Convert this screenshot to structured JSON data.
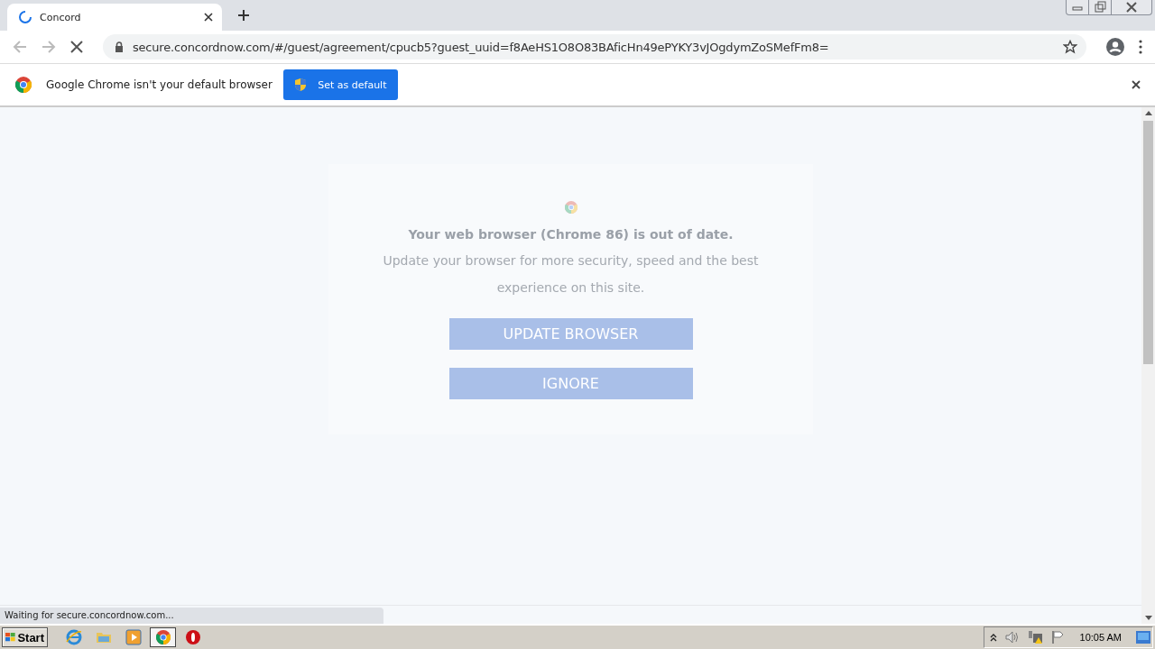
{
  "browser": {
    "tab": {
      "title": "Concord",
      "loading": true
    },
    "address": "secure.concordnow.com/#/guest/agreement/cpucb5?guest_uuid=f8AeHS1O8O83BAficHn49ePYKY3vJOgdymZoSMefFm8="
  },
  "infobar": {
    "message": "Google Chrome isn't your default browser",
    "button": "Set as default"
  },
  "page": {
    "heading": "Your web browser (Chrome 86) is out of date.",
    "body": "Update your browser for more security, speed and the best experience on this site.",
    "buttons": [
      "UPDATE BROWSER",
      "IGNORE"
    ]
  },
  "status": "Waiting for secure.concordnow.com...",
  "taskbar": {
    "start": "Start",
    "apps": [
      {
        "kind": "ie",
        "selected": false
      },
      {
        "kind": "folder",
        "selected": false
      },
      {
        "kind": "media",
        "selected": false
      },
      {
        "kind": "chrome",
        "selected": true
      },
      {
        "kind": "opera",
        "selected": false
      }
    ],
    "clock": "10:05 AM"
  }
}
